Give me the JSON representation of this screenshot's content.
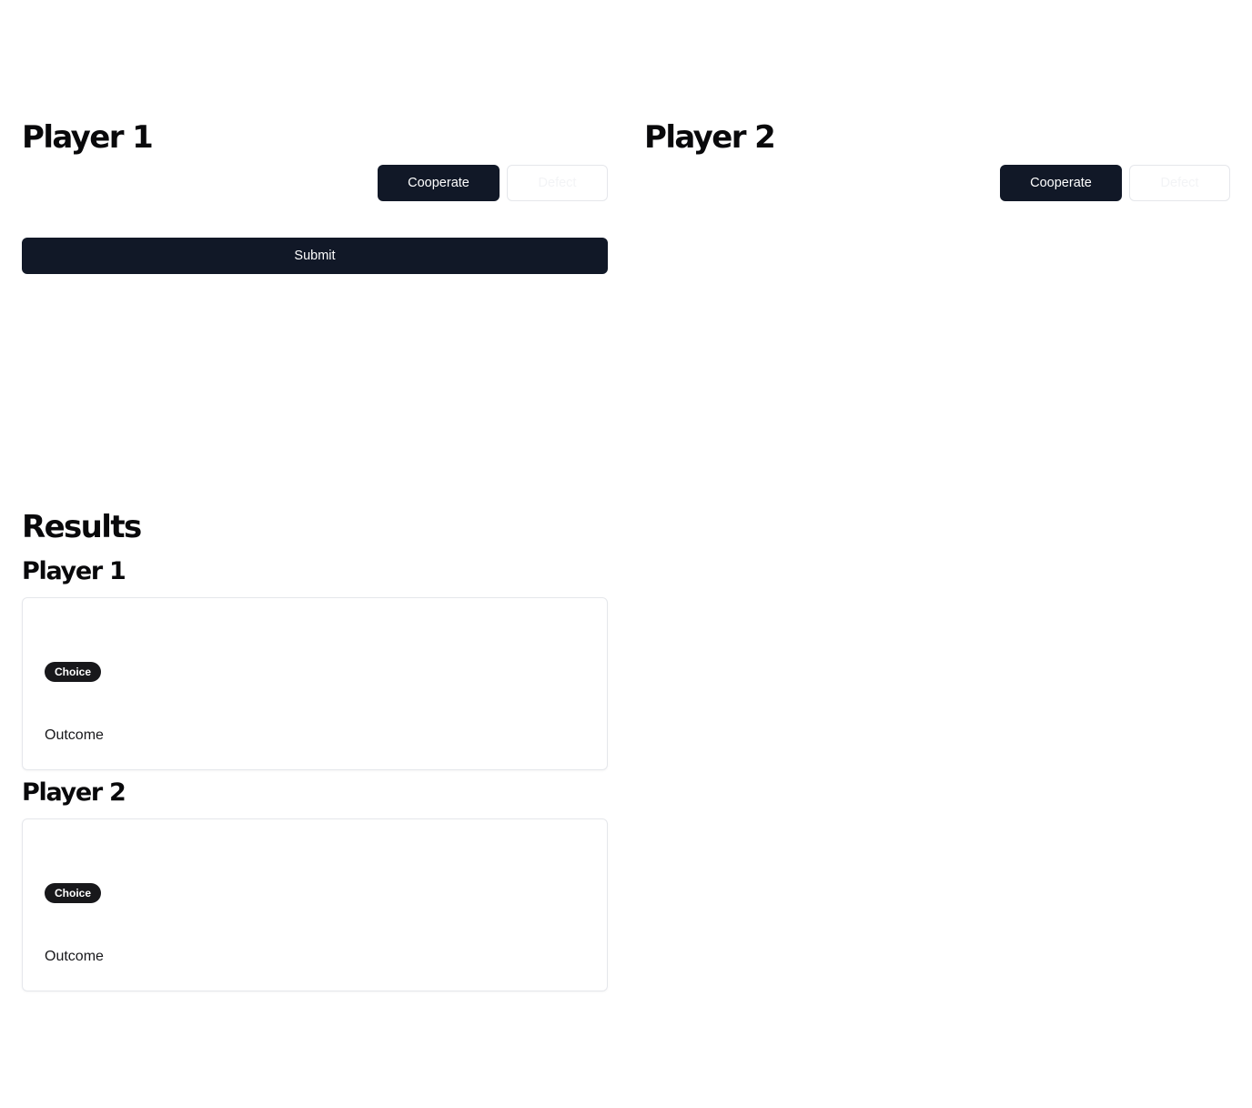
{
  "players": [
    {
      "heading": "Player 1",
      "cooperate_label": "Cooperate",
      "defect_label": "Defect",
      "submit_label": "Submit"
    },
    {
      "heading": "Player 2",
      "cooperate_label": "Cooperate",
      "defect_label": "Defect"
    }
  ],
  "results": {
    "title": "Results",
    "entries": [
      {
        "heading": "Player 1",
        "choice_badge": "Choice",
        "outcome_label": "Outcome"
      },
      {
        "heading": "Player 2",
        "choice_badge": "Choice",
        "outcome_label": "Outcome"
      }
    ]
  },
  "colors": {
    "primary": "#111827",
    "badge": "#18181b",
    "border": "#e5e7eb"
  }
}
